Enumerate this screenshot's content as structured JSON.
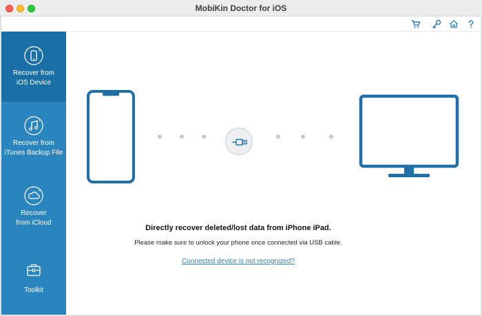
{
  "window": {
    "title": "MobiKin Doctor for iOS"
  },
  "toolbar": {
    "icons": [
      "cart-icon",
      "key-icon",
      "home-icon",
      "help-icon"
    ]
  },
  "sidebar": {
    "items": [
      {
        "label": "Recover from\niOS Device",
        "icon": "phone-refresh-icon",
        "active": true
      },
      {
        "label": "Recover from\niTunes Backup File",
        "icon": "music-note-icon",
        "active": false
      },
      {
        "label": "Recover\nfrom iCloud",
        "icon": "cloud-icon",
        "active": false
      },
      {
        "label": "Toolkit",
        "icon": "toolbox-icon",
        "active": false
      }
    ]
  },
  "main": {
    "headline": "Directly recover deleted/lost data from iPhone iPad.",
    "instruction": "Please make sure to unlock your phone once connected via USB cable.",
    "help_link": "Connected device is not recognized?"
  },
  "colors": {
    "sidebar_bg": "#2a84bd",
    "sidebar_active": "#1a6fa6",
    "accent": "#1f6fa8",
    "link": "#2a7fbf"
  }
}
